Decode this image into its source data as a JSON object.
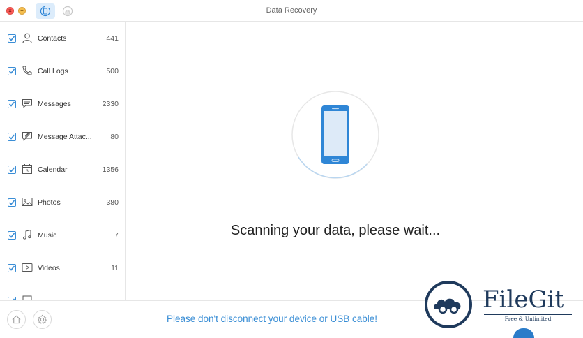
{
  "window": {
    "title": "Data Recovery"
  },
  "sidebar": {
    "items": [
      {
        "label": "Contacts",
        "count": "441",
        "icon": "contact-icon",
        "checked": true
      },
      {
        "label": "Call Logs",
        "count": "500",
        "icon": "phone-icon",
        "checked": true
      },
      {
        "label": "Messages",
        "count": "2330",
        "icon": "message-icon",
        "checked": true
      },
      {
        "label": "Message Attac...",
        "count": "80",
        "icon": "attachment-icon",
        "checked": true
      },
      {
        "label": "Calendar",
        "count": "1356",
        "icon": "calendar-icon",
        "checked": true
      },
      {
        "label": "Photos",
        "count": "380",
        "icon": "photo-icon",
        "checked": true
      },
      {
        "label": "Music",
        "count": "7",
        "icon": "music-icon",
        "checked": true
      },
      {
        "label": "Videos",
        "count": "11",
        "icon": "video-icon",
        "checked": true
      }
    ]
  },
  "main": {
    "status": "Scanning your data, please wait..."
  },
  "footer": {
    "warning": "Please don't disconnect your device or USB cable!"
  },
  "watermark": {
    "title": "FileGit",
    "subtitle": "Free & Unlimited"
  },
  "colors": {
    "accent": "#3a8ed5",
    "phone": "#2f86d6"
  }
}
